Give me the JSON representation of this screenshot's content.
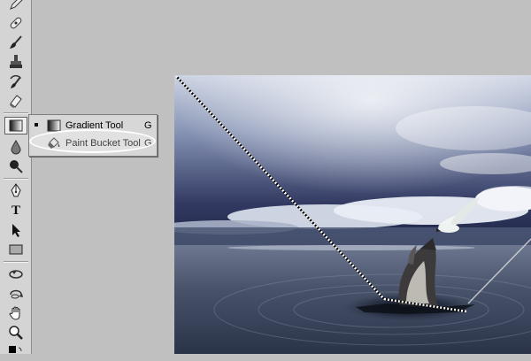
{
  "toolbar": {
    "tools": [
      {
        "name": "pencil-tool",
        "icon": "pencil-icon"
      },
      {
        "name": "healing-brush-tool",
        "icon": "bandage-icon"
      },
      {
        "name": "brush-tool",
        "icon": "brush-icon"
      },
      {
        "name": "clone-stamp-tool",
        "icon": "stamp-icon"
      },
      {
        "name": "history-brush-tool",
        "icon": "history-brush-icon"
      },
      {
        "name": "eraser-tool",
        "icon": "eraser-icon"
      },
      {
        "name": "gradient-tool",
        "icon": "gradient-icon",
        "active": true
      },
      {
        "name": "blur-tool",
        "icon": "drop-icon"
      },
      {
        "name": "dodge-tool",
        "icon": "dodge-icon"
      },
      {
        "name": "pen-tool",
        "icon": "pen-icon"
      },
      {
        "name": "type-tool",
        "icon": "type-icon",
        "label": "T"
      },
      {
        "name": "path-selection-tool",
        "icon": "arrow-icon"
      },
      {
        "name": "rectangle-tool",
        "icon": "rectangle-icon"
      },
      {
        "name": "3d-rotate-tool",
        "icon": "3d-rotate-icon"
      },
      {
        "name": "3d-orbit-tool",
        "icon": "3d-orbit-icon"
      },
      {
        "name": "hand-tool",
        "icon": "hand-icon"
      },
      {
        "name": "zoom-tool",
        "icon": "zoom-icon"
      }
    ]
  },
  "flyout": {
    "items": [
      {
        "label": "Gradient Tool",
        "shortcut": "G",
        "selected": true,
        "icon": "gradient-icon"
      },
      {
        "label": "Paint Bucket Tool",
        "shortcut": "G",
        "selected": false,
        "icon": "paint-bucket-icon"
      }
    ]
  },
  "colors": {
    "toolbar_bg": "#d4d4d4",
    "workspace_bg": "#c0c0c0",
    "sky_dark": "#1d2445",
    "sea": "#48536a"
  }
}
